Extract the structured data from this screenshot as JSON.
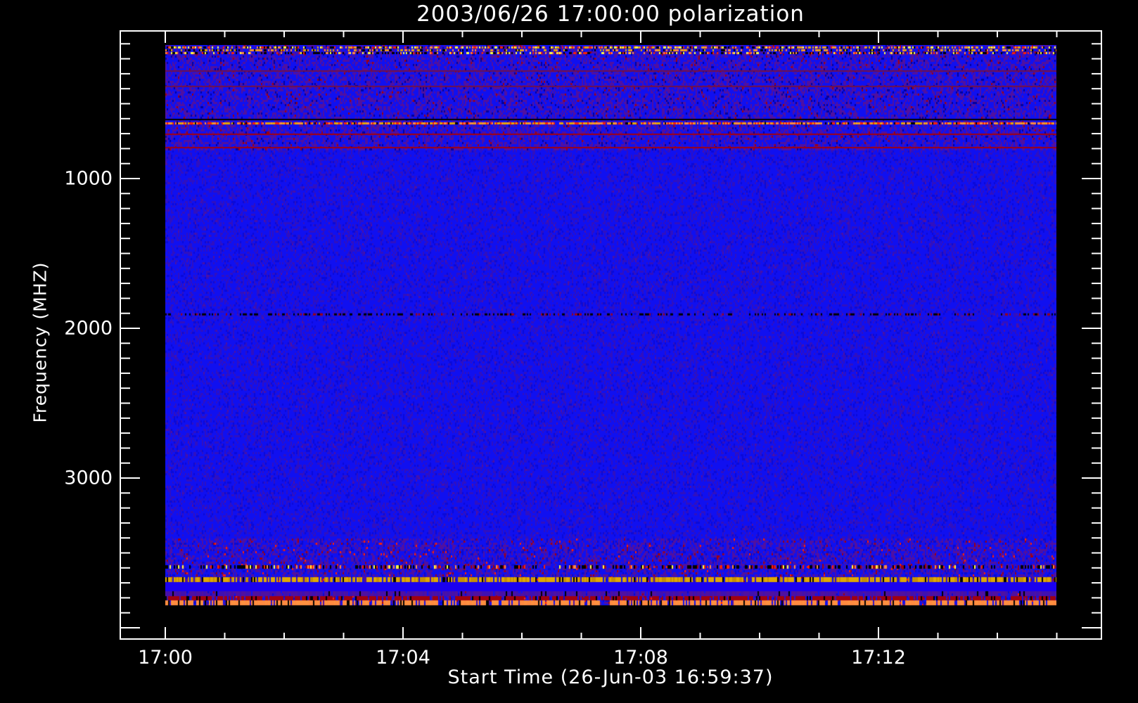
{
  "chart_data": {
    "type": "heatmap",
    "title": "2003/06/26 17:00:00 polarization",
    "xlabel": "Start Time (26-Jun-03 16:59:37)",
    "ylabel": "Frequency (MHZ)",
    "x_ticks": [
      {
        "label": "17:00",
        "minutes": 0
      },
      {
        "label": "17:04",
        "minutes": 4
      },
      {
        "label": "17:08",
        "minutes": 8
      },
      {
        "label": "17:12",
        "minutes": 12
      }
    ],
    "y_ticks": [
      {
        "label": "1000",
        "value": 1000
      },
      {
        "label": "2000",
        "value": 2000
      },
      {
        "label": "3000",
        "value": 3000
      }
    ],
    "xlim_minutes_after_1700": [
      -0.77,
      15.77
    ],
    "data_x_range_minutes": [
      0,
      15
    ],
    "ylim_mhz": [
      4085,
      10
    ],
    "data_y_range_mhz": [
      108,
      3990
    ],
    "y_inverted": true,
    "x_minor_tick_step_minutes": 1,
    "y_minor_tick_step_mhz": 100,
    "colormap": [
      "#000000",
      "#1010f0",
      "#5010a0",
      "#a00010",
      "#ff2000",
      "#ff8a40",
      "#e0a800",
      "#ffff40"
    ],
    "background": "#1010f0"
  }
}
